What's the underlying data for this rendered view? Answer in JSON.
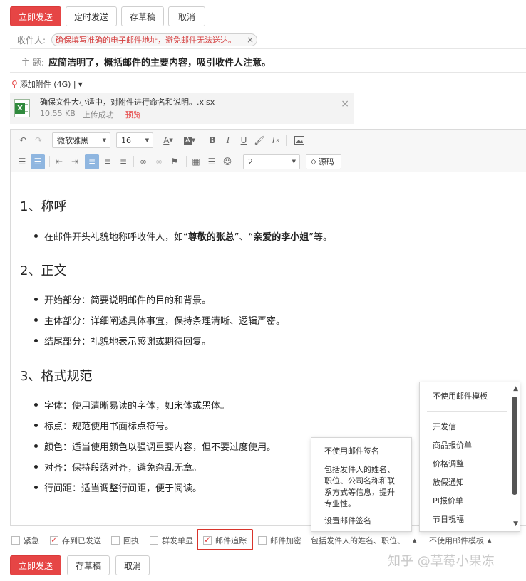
{
  "top_actions": {
    "send": "立即发送",
    "schedule": "定时发送",
    "draft": "存草稿",
    "cancel": "取消"
  },
  "recipient": {
    "label": "收件人:",
    "chip": "确保填写准确的电子邮件地址，避免邮件无法送达。",
    "remove": "×"
  },
  "subject": {
    "label": "主 题:",
    "value": "应简洁明了，概括邮件的主要内容，吸引收件人注意。"
  },
  "attachment": {
    "add_label": "添加附件 (4G) |",
    "name": "确保文件大小适中，对附件进行命名和说明。.xlsx",
    "size": "10.55 KB",
    "status": "上传成功",
    "preview": "预览",
    "remove": "×"
  },
  "toolbar": {
    "font": "微软雅黑",
    "size": "16",
    "line_height": "2",
    "source": "源码",
    "bold": "B",
    "italic": "I",
    "underline": "U"
  },
  "content": {
    "s1": {
      "heading": "1、称呼",
      "items": [
        {
          "pre": "在邮件开头礼貌地称呼收件人，如“",
          "b1": "尊敬的张总",
          "mid": "”、“",
          "b2": "亲爱的李小姐",
          "post": "”等。"
        }
      ]
    },
    "s2": {
      "heading": "2、正文",
      "items": [
        "开始部分：简要说明邮件的目的和背景。",
        "主体部分：详细阐述具体事宜，保持条理清晰、逻辑严密。",
        "结尾部分：礼貌地表示感谢或期待回复。"
      ]
    },
    "s3": {
      "heading": "3、格式规范",
      "items": [
        "字体：使用清晰易读的字体，如宋体或黑体。",
        "标点：规范使用书面标点符号。",
        "颜色：适当使用颜色以强调重要内容，但不要过度使用。",
        "对齐：保持段落对齐，避免杂乱无章。",
        "行间距：适当调整行间距，便于阅读。"
      ]
    }
  },
  "signature_popup": {
    "none": "不使用邮件签名",
    "desc": [
      "包括发件人的姓名、",
      "职位、公司名称和联",
      "系方式等信息，提升",
      "专业性。"
    ],
    "setup": "设置邮件签名"
  },
  "template_popup": {
    "none": "不使用邮件模板",
    "items": [
      "开发信",
      "商品报价单",
      "价格调整",
      "放假通知",
      "PI报价单",
      "节日祝福"
    ]
  },
  "options": {
    "urgent": "紧急",
    "save_sent": "存到已发送",
    "receipt": "回执",
    "single": "群发单显",
    "tracking": "邮件追踪",
    "encrypt": "邮件加密",
    "signature_select": "包括发件人的姓名、职位、",
    "template_select": "不使用邮件模板"
  },
  "bottom_actions": {
    "send": "立即发送",
    "draft": "存草稿",
    "cancel": "取消"
  },
  "watermark": "知乎 @草莓小果冻",
  "colors": {
    "primary": "#e64545",
    "highlight": "#d9342b",
    "selected_tool": "#8fb6e0"
  }
}
